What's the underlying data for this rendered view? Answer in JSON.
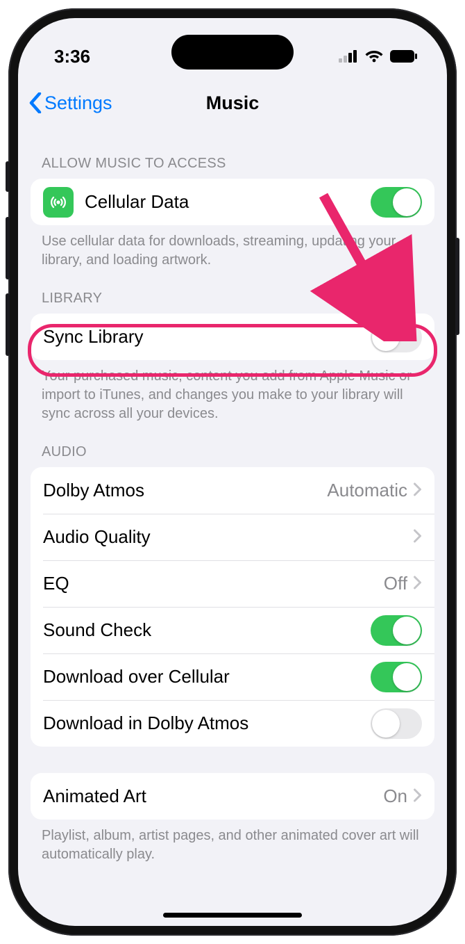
{
  "status": {
    "time": "3:36"
  },
  "nav": {
    "back": "Settings",
    "title": "Music"
  },
  "sections": {
    "access": {
      "header": "ALLOW MUSIC TO ACCESS",
      "cellular": {
        "label": "Cellular Data"
      },
      "footer": "Use cellular data for downloads, streaming, updating your library, and loading artwork."
    },
    "library": {
      "header": "LIBRARY",
      "sync": {
        "label": "Sync Library"
      },
      "footer": "Your purchased music, content you add from Apple Music or import to iTunes, and changes you make to your library will sync across all your devices."
    },
    "audio": {
      "header": "AUDIO",
      "dolby": {
        "label": "Dolby Atmos",
        "value": "Automatic"
      },
      "quality": {
        "label": "Audio Quality"
      },
      "eq": {
        "label": "EQ",
        "value": "Off"
      },
      "sound_check": {
        "label": "Sound Check"
      },
      "dl_cellular": {
        "label": "Download over Cellular"
      },
      "dl_dolby": {
        "label": "Download in Dolby Atmos"
      }
    },
    "art": {
      "animated": {
        "label": "Animated Art",
        "value": "On"
      },
      "footer": "Playlist, album, artist pages, and other animated cover art will automatically play."
    }
  }
}
